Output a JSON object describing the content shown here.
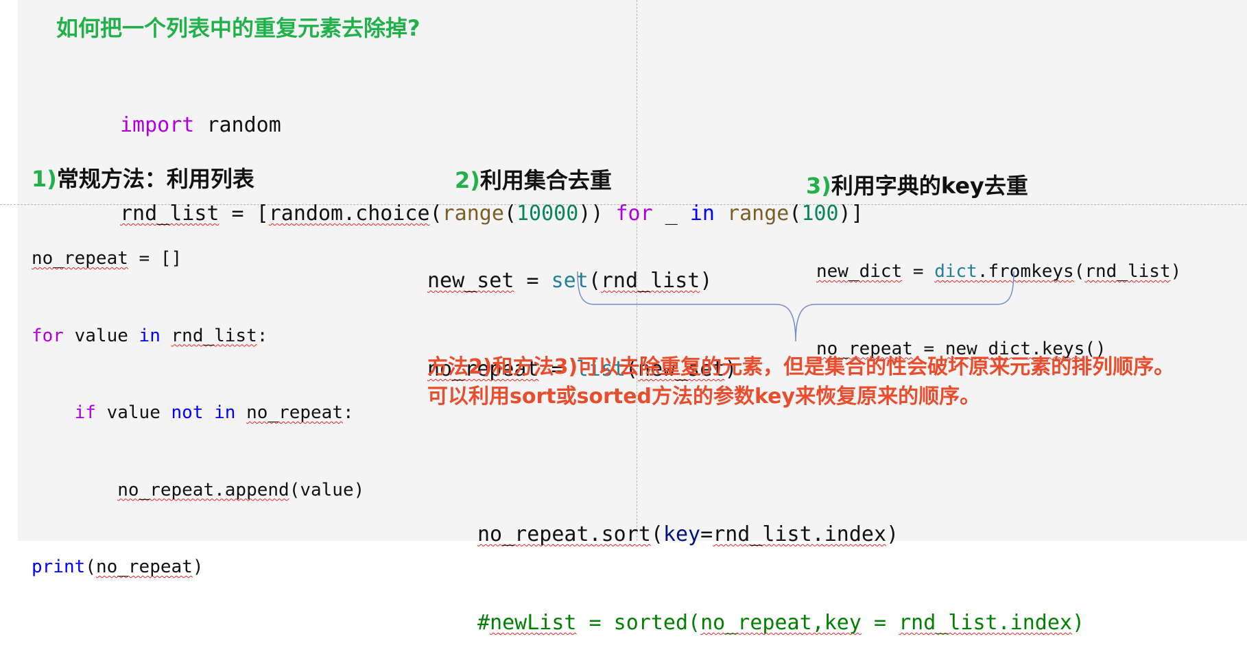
{
  "title": "如何把一个列表中的重复元素去除掉?",
  "setup_code": {
    "import_kw": "import",
    "import_mod": " random",
    "l2_var": "rnd_list",
    "l2_eq": " = [",
    "l2_call": "random.choice",
    "l2_paren": "(",
    "l2_range1": "range",
    "l2_paren2": "(",
    "l2_num1": "10000",
    "l2_close1": ")) ",
    "l2_for": "for",
    "l2_us": " _ ",
    "l2_in": "in",
    "l2_sp": " ",
    "l2_range2": "range",
    "l2_paren3": "(",
    "l2_num2": "100",
    "l2_close2": ")]"
  },
  "method1": {
    "heading_num": "1)",
    "heading_text": "常规方法：利用列表",
    "c1_var": "no_repeat",
    "c1_rest": " = []",
    "c2_for": "for",
    "c2_mid": " value ",
    "c2_in": "in",
    "c2_sp": " ",
    "c2_list": "rnd_list",
    "c2_colon": ":",
    "c3_indent": "    ",
    "c3_if": "if",
    "c3_mid": " value ",
    "c3_not": "not",
    "c3_sp": " ",
    "c3_in": "in",
    "c3_sp2": " ",
    "c3_var": "no_repeat",
    "c3_colon": ":",
    "c4_indent": "        ",
    "c4_call": "no_repeat.append",
    "c4_rest": "(value)",
    "c5_print": "print",
    "c5_open": "(",
    "c5_var": "no_repeat",
    "c5_close": ")"
  },
  "method2": {
    "heading_num": "2)",
    "heading_text": "利用集合去重",
    "c1_var": "new_set",
    "c1_eq": " = ",
    "c1_fn": "set",
    "c1_open": "(",
    "c1_arg": "rnd_list",
    "c1_close": ")",
    "c2_var": "no_repeat",
    "c2_eq": " = ",
    "c2_fn": "list",
    "c2_open": "(",
    "c2_arg": "new_set",
    "c2_close": ")"
  },
  "method3": {
    "heading_num": "3)",
    "heading_text": "利用字典的key去重",
    "c1_var": "new_dict",
    "c1_eq": " = ",
    "c1_fn": "dict",
    "c1_method": ".fromkeys",
    "c1_open": "(",
    "c1_arg": "rnd_list",
    "c1_close": ")",
    "c2_var": "no_repeat",
    "c2_eq": " = ",
    "c2_call": "new_dict.keys",
    "c2_rest": "()"
  },
  "note": {
    "line1": "方法2)和方法3)可以去除重复的元素，但是集合的性会破坏原来元素的排列顺序。",
    "line2": "可以利用sort或sorted方法的参数key来恢复原来的顺序。"
  },
  "sort_code": {
    "c1_call": "no_repeat.sort",
    "c1_open": "(",
    "c1_key": "key",
    "c1_eq": "=",
    "c1_val": "rnd_list.index",
    "c1_close": ")",
    "c2_hash": "#",
    "c2_new": "newList",
    "c2_mid": " = sorted(",
    "c2_arg1": "no_repeat,key",
    "c2_eq": " = ",
    "c2_arg2": "rnd_list.index",
    "c2_close": ")"
  },
  "colors": {
    "title_green": "#21b14a",
    "note_red": "#e84d2d",
    "keyword_purple": "#af00db",
    "keyword_blue": "#0000ff",
    "builtin_brown": "#795e26",
    "number_green": "#098658",
    "type_teal": "#267f99",
    "comment_green": "#008000",
    "brace_blue": "#6f8fc8",
    "slide_bg": "#f4f4f4"
  }
}
